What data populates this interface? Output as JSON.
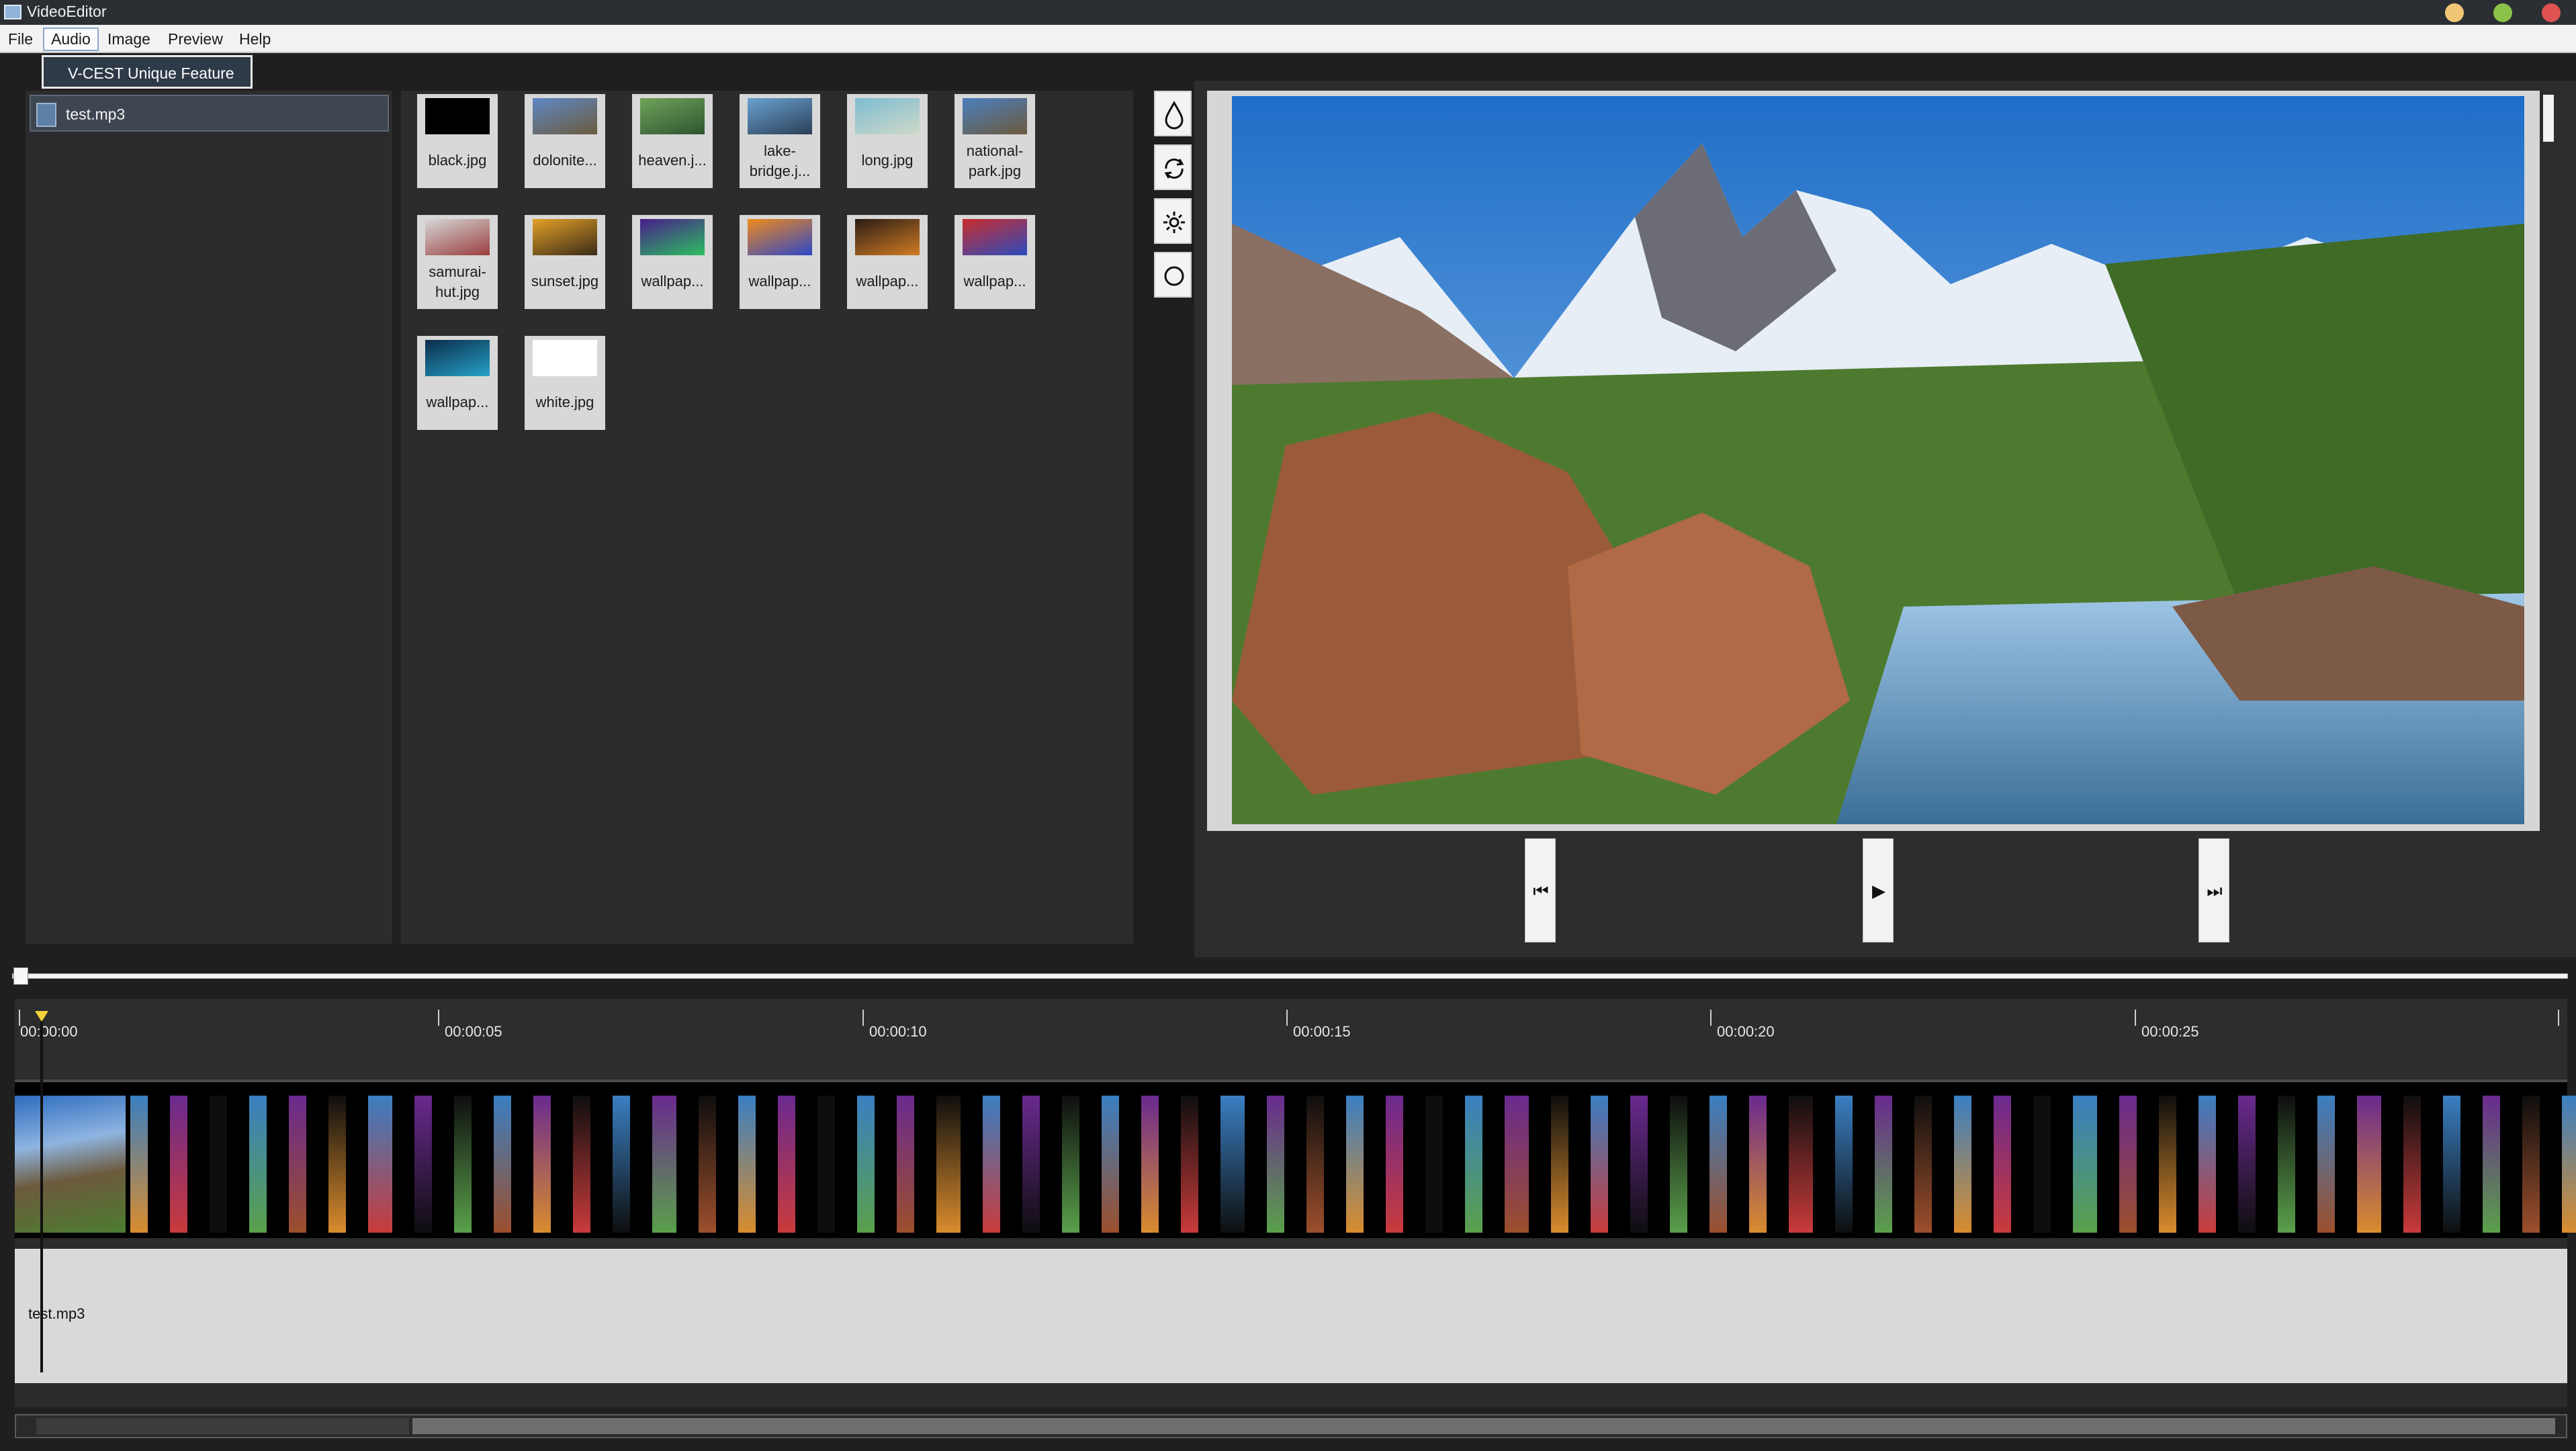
{
  "window": {
    "title": "VideoEditor",
    "buttons": {
      "minimize_color": "#f0c674",
      "maximize_color": "#8bc34a",
      "close_color": "#e05252"
    }
  },
  "menubar": {
    "items": [
      "File",
      "Audio",
      "Image",
      "Preview",
      "Help"
    ],
    "open_menu": "Audio"
  },
  "dropdown": {
    "items": [
      "V-CEST Unique Feature"
    ]
  },
  "media_list": {
    "items": [
      {
        "icon": "audio-file-icon",
        "label": "test.mp3"
      }
    ]
  },
  "image_library": {
    "thumbnails": [
      {
        "caption": "black.jpg",
        "colors": [
          "#000000",
          "#000000"
        ]
      },
      {
        "caption": "dolonite...",
        "colors": [
          "#5f88c6",
          "#6b5b3c"
        ]
      },
      {
        "caption": "heaven.j...",
        "colors": [
          "#6fa35a",
          "#2e5530"
        ]
      },
      {
        "caption": "lake-\nbridge.j...",
        "colors": [
          "#6aa2d1",
          "#2b3f57"
        ]
      },
      {
        "caption": "long.jpg",
        "colors": [
          "#7dbcd2",
          "#cfd9c8"
        ]
      },
      {
        "caption": "national-\npark.jpg",
        "colors": [
          "#4c7fc0",
          "#6b5a3b"
        ]
      },
      {
        "caption": "samurai-\nhut.jpg",
        "colors": [
          "#d7d7d7",
          "#9a3d3d"
        ]
      },
      {
        "caption": "sunset.jpg",
        "colors": [
          "#e3a127",
          "#3a2a18"
        ]
      },
      {
        "caption": "wallpap...",
        "colors": [
          "#4a1d8c",
          "#2bbf5f"
        ]
      },
      {
        "caption": "wallpap...",
        "colors": [
          "#f08a1c",
          "#2c47c9"
        ]
      },
      {
        "caption": "wallpap...",
        "colors": [
          "#2a1c14",
          "#d27c24"
        ]
      },
      {
        "caption": "wallpap...",
        "colors": [
          "#c92d2d",
          "#2c4bbd"
        ]
      },
      {
        "caption": "wallpap...",
        "colors": [
          "#0c2c4a",
          "#24a2c8"
        ]
      },
      {
        "caption": "white.jpg",
        "colors": [
          "#ffffff",
          "#ffffff"
        ]
      }
    ]
  },
  "tools": [
    {
      "name": "drop-icon"
    },
    {
      "name": "rotate-icon"
    },
    {
      "name": "brightness-icon"
    },
    {
      "name": "circle-icon"
    }
  ],
  "controls": {
    "prev": "⏮",
    "play": "▶",
    "next": "⏭"
  },
  "timeline": {
    "ticks": [
      "00:00:00",
      "00:00:05",
      "00:00:10",
      "00:00:15",
      "00:00:20",
      "00:00:25"
    ],
    "audio_label": "test.mp3",
    "playhead_color": "#f2d23a"
  }
}
